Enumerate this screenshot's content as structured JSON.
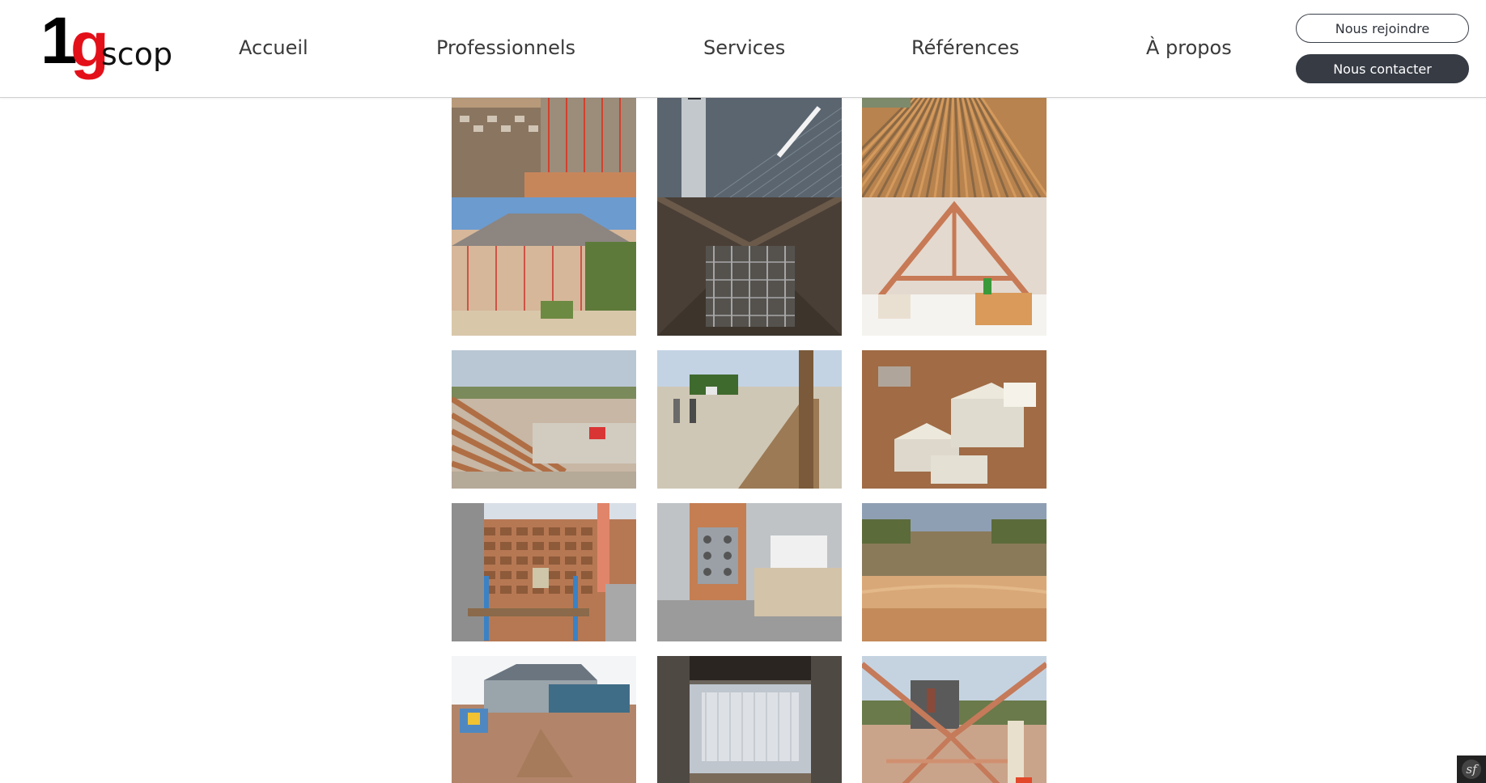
{
  "logo": {
    "one": "1",
    "g": "g",
    "scop": "scop"
  },
  "nav": {
    "items": [
      "Accueil",
      "Professionnels",
      "Services",
      "Références",
      "À propos"
    ]
  },
  "buttons": {
    "join_label": "Nous rejoindre",
    "contact_label": "Nous contacter"
  },
  "gallery": {
    "photos": [
      "construction-site-stone-walls-scaffolding",
      "roofers-on-slate-roof",
      "roof-timber-battens",
      "house-renovation-scaffolding-blue-sky",
      "attic-interior-scaffolding",
      "attic-timber-trusses-insulation",
      "roof-rafters-worksite-field",
      "stone-wall-trench-workers",
      "white-limestone-blocks",
      "stone-wall-blue-posts",
      "timber-post-steel-bracket",
      "earth-embankment-excavation",
      "excavator-demolition-site",
      "interior-insulated-wall",
      "timber-roof-frame-brick-chimney"
    ]
  },
  "colors": {
    "accent_red": "#e3101a",
    "dark_button": "#363b44",
    "nav_text": "#3a3a3a"
  }
}
